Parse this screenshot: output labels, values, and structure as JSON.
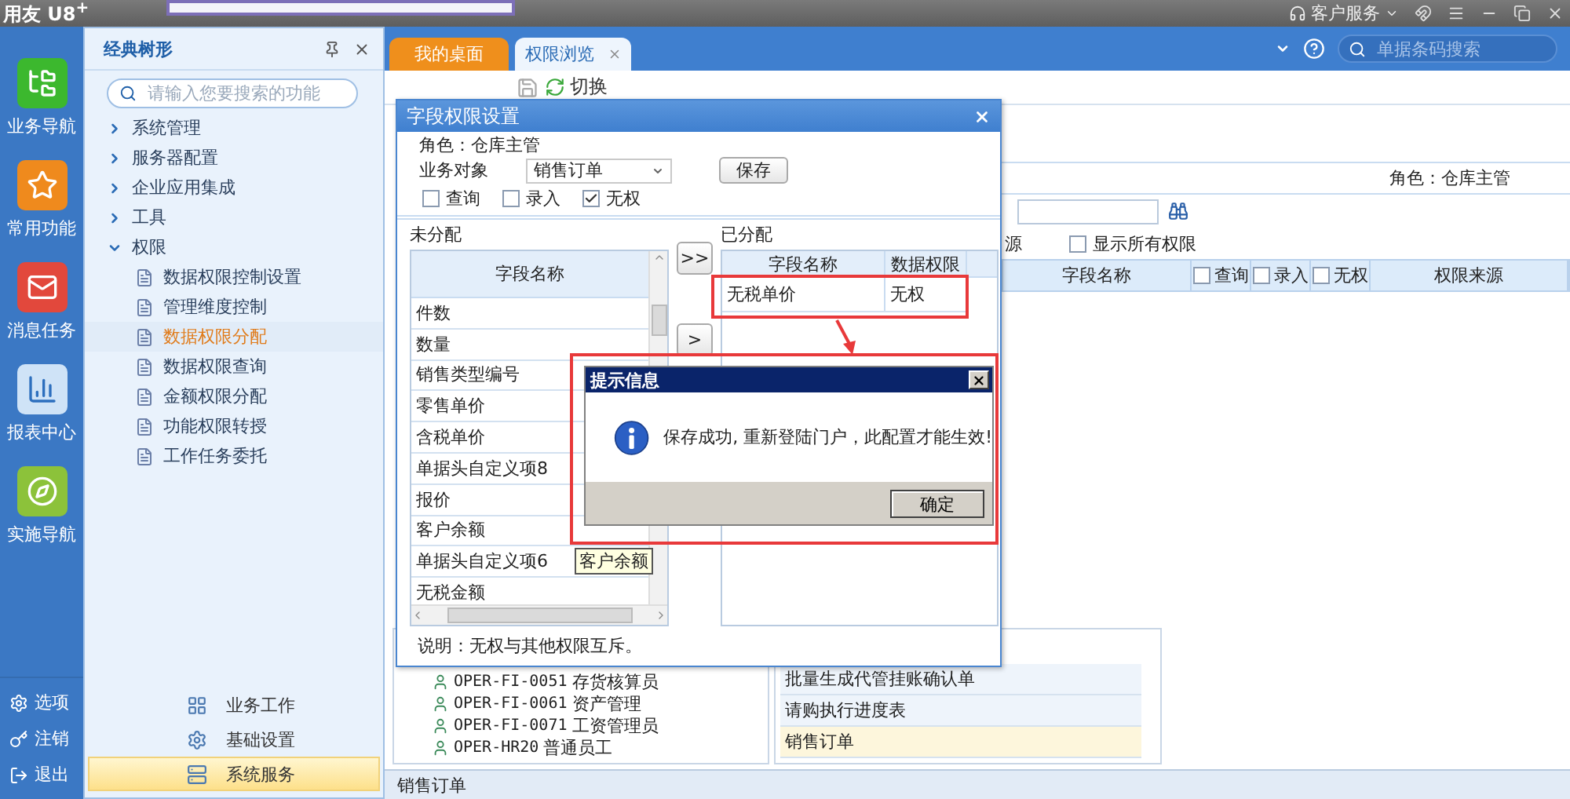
{
  "app": {
    "logo": "用友 U8$^{+}$",
    "service": "客户服务"
  },
  "rail": {
    "items": [
      {
        "label": "业务导航"
      },
      {
        "label": "常用功能"
      },
      {
        "label": "消息任务"
      },
      {
        "label": "报表中心"
      },
      {
        "label": "实施导航"
      }
    ],
    "bottom": [
      {
        "label": "选项"
      },
      {
        "label": "注销"
      },
      {
        "label": "退出"
      }
    ]
  },
  "tree_panel": {
    "title": "经典树形",
    "search_placeholder": "请输入您要搜索的功能",
    "items": [
      {
        "label": "系统管理",
        "expanded": false
      },
      {
        "label": "服务器配置",
        "expanded": false
      },
      {
        "label": "企业应用集成",
        "expanded": false
      },
      {
        "label": "工具",
        "expanded": false
      },
      {
        "label": "权限",
        "expanded": true,
        "children": [
          {
            "label": "数据权限控制设置",
            "selected": false
          },
          {
            "label": "管理维度控制",
            "selected": false
          },
          {
            "label": "数据权限分配",
            "selected": true
          },
          {
            "label": "数据权限查询",
            "selected": false
          },
          {
            "label": "金额权限分配",
            "selected": false
          },
          {
            "label": "功能权限转授",
            "selected": false
          },
          {
            "label": "工作任务委托",
            "selected": false
          }
        ]
      }
    ],
    "modules": [
      {
        "label": "业务工作",
        "selected": false
      },
      {
        "label": "基础设置",
        "selected": false
      },
      {
        "label": "系统服务",
        "selected": true
      }
    ]
  },
  "tabs": [
    {
      "label": "我的桌面",
      "selected": false,
      "closable": false
    },
    {
      "label": "权限浏览",
      "selected": true,
      "closable": true
    }
  ],
  "header_search": {
    "placeholder": "单据条码搜索"
  },
  "toolbar": [
    {
      "label": "切换"
    }
  ],
  "browse": {
    "role": "角色：仓库主管",
    "source_fragment": "源",
    "show_all": {
      "label": "显示所有权限",
      "checked": false
    },
    "columns": [
      {
        "label": "字段名称",
        "kind": "text"
      },
      {
        "label": "查询",
        "kind": "check",
        "checked": false
      },
      {
        "label": "录入",
        "kind": "check",
        "checked": false
      },
      {
        "label": "无权",
        "kind": "check",
        "checked": false
      },
      {
        "label": "权限来源",
        "kind": "text"
      }
    ]
  },
  "users": [
    {
      "code": "OPER-FI-0051",
      "name": "存货核算员"
    },
    {
      "code": "OPER-FI-0061",
      "name": "资产管理"
    },
    {
      "code": "OPER-FI-0071",
      "name": "工资管理员"
    },
    {
      "code": "OPER-HR20",
      "name": "普通员工"
    }
  ],
  "bills": [
    {
      "label": "批量生成代管挂账确认单",
      "selected": false
    },
    {
      "label": "请购执行进度表",
      "selected": false
    },
    {
      "label": "销售订单",
      "selected": true
    }
  ],
  "status_bar": "销售订单",
  "dialog": {
    "title": "字段权限设置",
    "role": "角色：仓库主管",
    "object_label": "业务对象",
    "object_value": "销售订单",
    "save": "保存",
    "perms": [
      {
        "label": "查询",
        "checked": false
      },
      {
        "label": "录入",
        "checked": false
      },
      {
        "label": "无权",
        "checked": true
      }
    ],
    "unassigned": {
      "title": "未分配",
      "column": "字段名称",
      "rows": [
        "件数",
        "数量",
        "销售类型编号",
        "零售单价",
        "含税单价",
        "单据头自定义项8",
        "报价",
        "客户余额",
        "单据头自定义项6",
        "无税金额"
      ]
    },
    "move_buttons": [
      ">>",
      ">"
    ],
    "assigned": {
      "title": "已分配",
      "columns": [
        "字段名称",
        "数据权限"
      ],
      "rows": [
        {
          "field": "无税单价",
          "perm": "无权"
        }
      ]
    },
    "note": "说明：无权与其他权限互斥。"
  },
  "message": {
    "title": "提示信息",
    "text": "保存成功, 重新登陆门户，此配置才能生效!",
    "ok": "确定"
  },
  "tooltip": "客户余额"
}
